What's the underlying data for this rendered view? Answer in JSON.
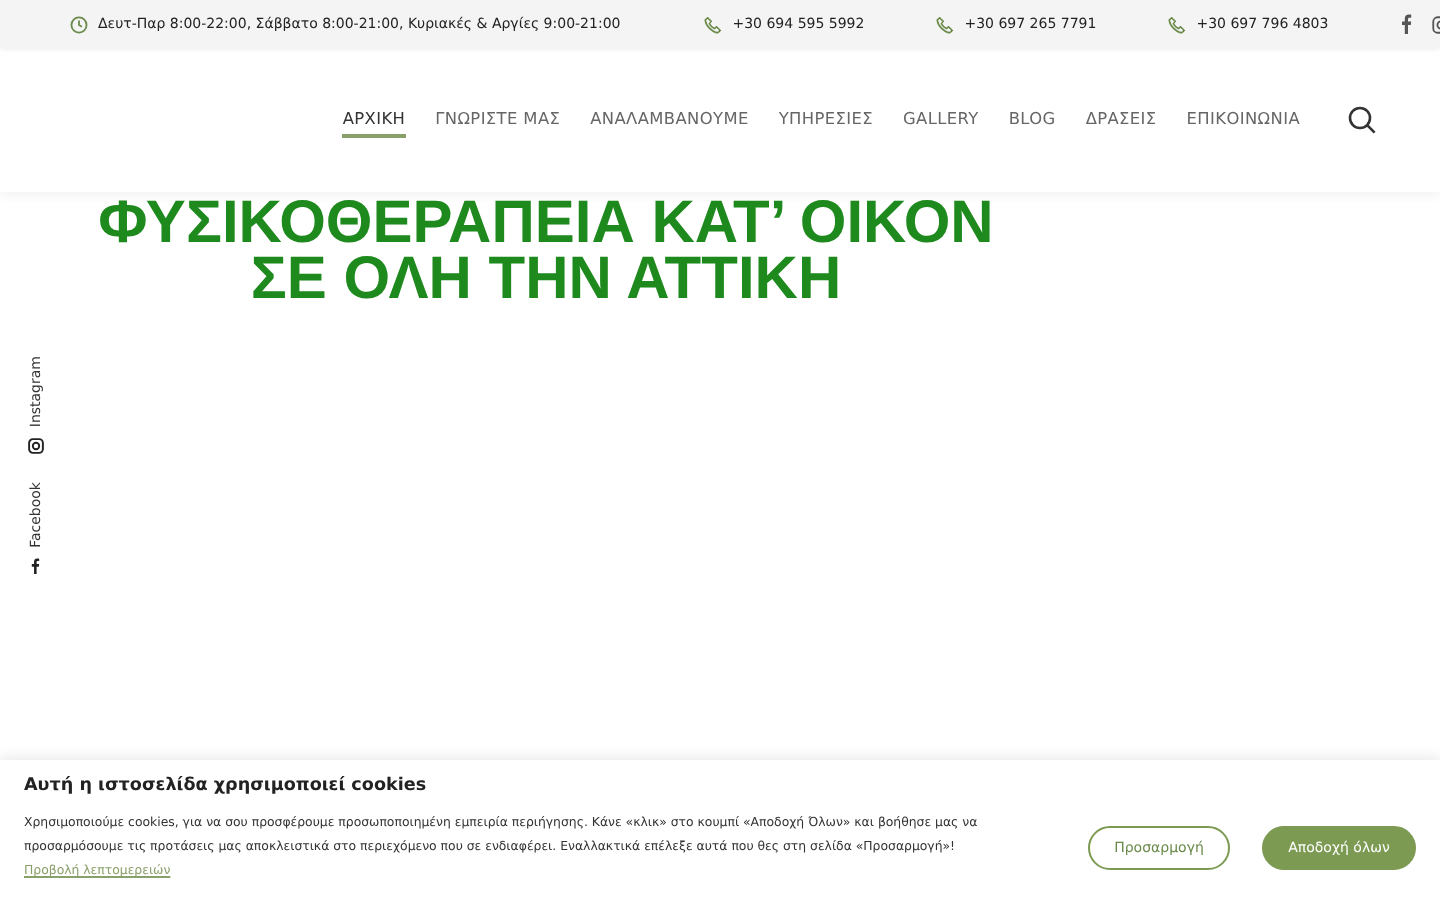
{
  "topbar": {
    "hours": "Δευτ-Παρ 8:00-22:00, Σάββατο 8:00-21:00, Κυριακές & Αργίες 9:00-21:00",
    "phones": [
      "+30 694 595 5992",
      "+30 697 265 7791",
      "+30 697 796 4803"
    ]
  },
  "nav": [
    {
      "label": "ΑΡΧΙΚΗ",
      "selected": true
    },
    {
      "label": "ΓΝΩΡΙΣΤΕ ΜΑΣ",
      "selected": false
    },
    {
      "label": "ΑΝΑΛΑΜΒΑΝΟΥΜΕ",
      "selected": false
    },
    {
      "label": "ΥΠΗΡΕΣΙΕΣ",
      "selected": false
    },
    {
      "label": "GALLERY",
      "selected": false
    },
    {
      "label": "BLOG",
      "selected": false
    },
    {
      "label": "ΔΡΑΣΕΙΣ",
      "selected": false
    },
    {
      "label": "ΕΠΙΚΟΙΝΩΝΙΑ",
      "selected": false
    }
  ],
  "hero": {
    "title_lines": [
      "ΦΥΣΙΚΟΘΕΡΑΠΕΙΑ ΚΑΤ’ ΟΙΚΟΝ",
      "ΣΕ ΟΛΗ ΤΗΝ ΑΤΤΙΚΗ"
    ]
  },
  "side_social": [
    {
      "kind": "instagram",
      "label": "Instagram"
    },
    {
      "kind": "facebook",
      "label": "Facebook"
    }
  ],
  "cookie_banner": {
    "title": "Αυτή η ιστοσελίδα χρησιμοποιεί cookies",
    "text": "Χρησιμοποιούμε cookies, για να σου προσφέρουμε προσωποποιημένη εμπειρία περιήγησης. Κάνε «κλικ» στο κουμπί «Αποδοχή Όλων» και βοήθησε μας να προσαρμόσουμε τις προτάσεις μας αποκλειστικά στο περιεχόμενο που σε ενδιαφέρει. Εναλλακτικά επέλεξε αυτά που θες στη σελίδα «Προσαρμογή»!",
    "link": "Προβολή λεπτομερειών",
    "buttons": [
      {
        "kind": "outline",
        "label": "Προσαρμογή"
      },
      {
        "kind": "filled",
        "label": "Αποδοχή όλων"
      }
    ]
  }
}
